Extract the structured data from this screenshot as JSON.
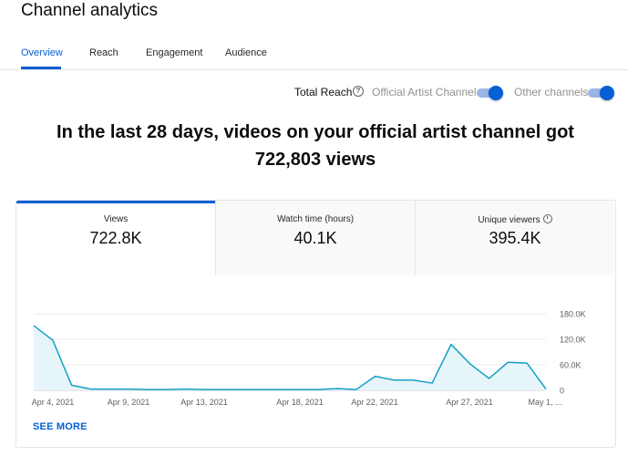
{
  "page": {
    "title": "Channel analytics"
  },
  "tabs": [
    {
      "label": "Overview",
      "active": true
    },
    {
      "label": "Reach",
      "active": false
    },
    {
      "label": "Engagement",
      "active": false
    },
    {
      "label": "Audience",
      "active": false
    }
  ],
  "filters": {
    "total_reach_label": "Total Reach",
    "help_glyph": "?",
    "official_channel_label": "Official Artist Channel",
    "official_channel_on": true,
    "other_channels_label": "Other channels",
    "other_channels_on": true
  },
  "headline": {
    "line1": "In the last 28 days, videos on your official artist channel got",
    "line2": "722,803 views"
  },
  "metrics": [
    {
      "label": "Views",
      "value": "722.8K",
      "active": true
    },
    {
      "label": "Watch time (hours)",
      "value": "40.1K",
      "active": false
    },
    {
      "label": "Unique viewers",
      "value": "395.4K",
      "active": false
    }
  ],
  "see_more": "SEE MORE",
  "colors": {
    "accent": "#065fd4",
    "line": "#11a0c6",
    "fill": "#e6f5f9"
  },
  "chart_data": {
    "type": "area",
    "x": [
      "Apr 3",
      "Apr 4",
      "Apr 5",
      "Apr 6",
      "Apr 7",
      "Apr 8",
      "Apr 9",
      "Apr 10",
      "Apr 11",
      "Apr 12",
      "Apr 13",
      "Apr 14",
      "Apr 15",
      "Apr 16",
      "Apr 17",
      "Apr 18",
      "Apr 19",
      "Apr 20",
      "Apr 21",
      "Apr 22",
      "Apr 23",
      "Apr 24",
      "Apr 25",
      "Apr 26",
      "Apr 27",
      "Apr 28",
      "Apr 29",
      "Apr 30"
    ],
    "series": [
      {
        "values": [
          152000,
          118000,
          12000,
          3000,
          3000,
          3000,
          2000,
          2000,
          3000,
          2000,
          2000,
          2000,
          2000,
          2000,
          2000,
          2000,
          4000,
          2000,
          33000,
          24000,
          24000,
          17000,
          108000,
          62000,
          28000,
          66000,
          64000,
          3000
        ]
      }
    ],
    "xticks": [
      "Apr 4, 2021",
      "Apr 9, 2021",
      "Apr 13, 2021",
      "Apr 18, 2021",
      "Apr 22, 2021",
      "Apr 27, 2021",
      "May 1, ..."
    ],
    "yticks": [
      "0",
      "60.0K",
      "120.0K",
      "180.0K"
    ],
    "ylim": [
      0,
      180000
    ],
    "grid": true
  }
}
